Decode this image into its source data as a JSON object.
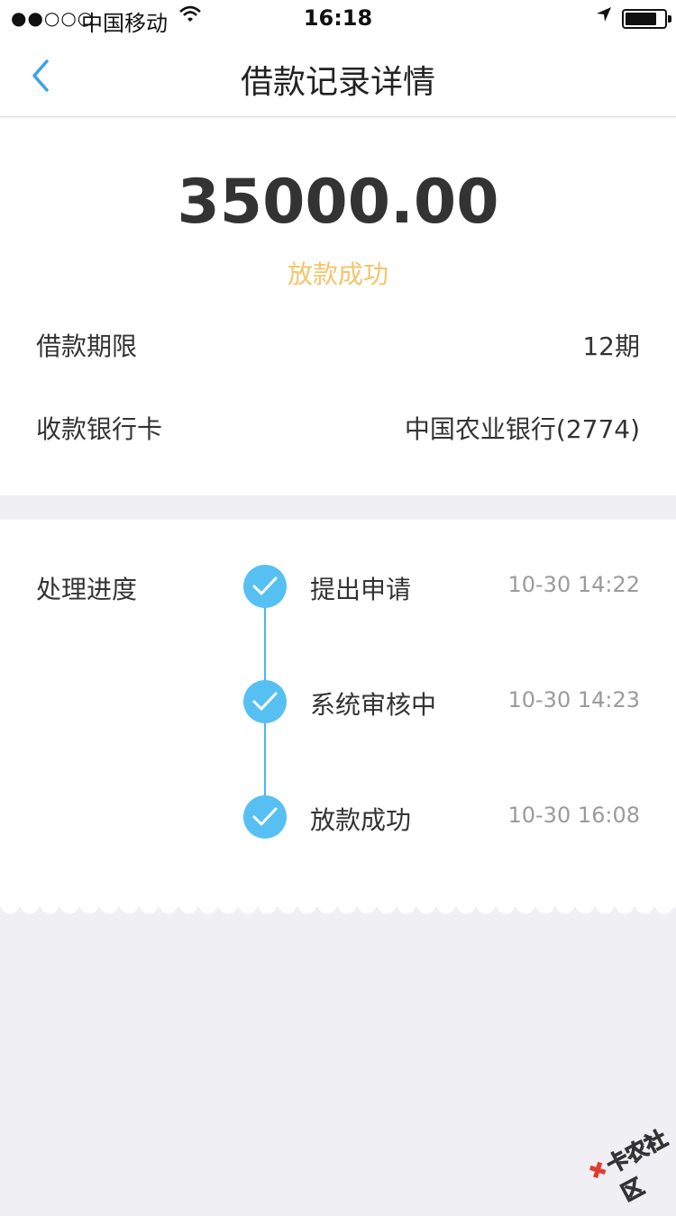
{
  "status_bar": {
    "signal": "●●○○○",
    "carrier": "中国移动",
    "time": "16:18"
  },
  "nav": {
    "title": "借款记录详情"
  },
  "summary": {
    "amount": "35000.00",
    "status": "放款成功",
    "status_color": "#f2c56b",
    "term_label": "借款期限",
    "term_value": "12期",
    "bank_label": "收款银行卡",
    "bank_value": "中国农业银行(2774)"
  },
  "progress": {
    "label": "处理进度",
    "accent_color": "#56c0f3",
    "steps": [
      {
        "name": "提出申请",
        "time": "10-30 14:22"
      },
      {
        "name": "系统审核中",
        "time": "10-30 14:23"
      },
      {
        "name": "放款成功",
        "time": "10-30 16:08"
      }
    ]
  },
  "watermark": {
    "text": "卡农社区"
  }
}
